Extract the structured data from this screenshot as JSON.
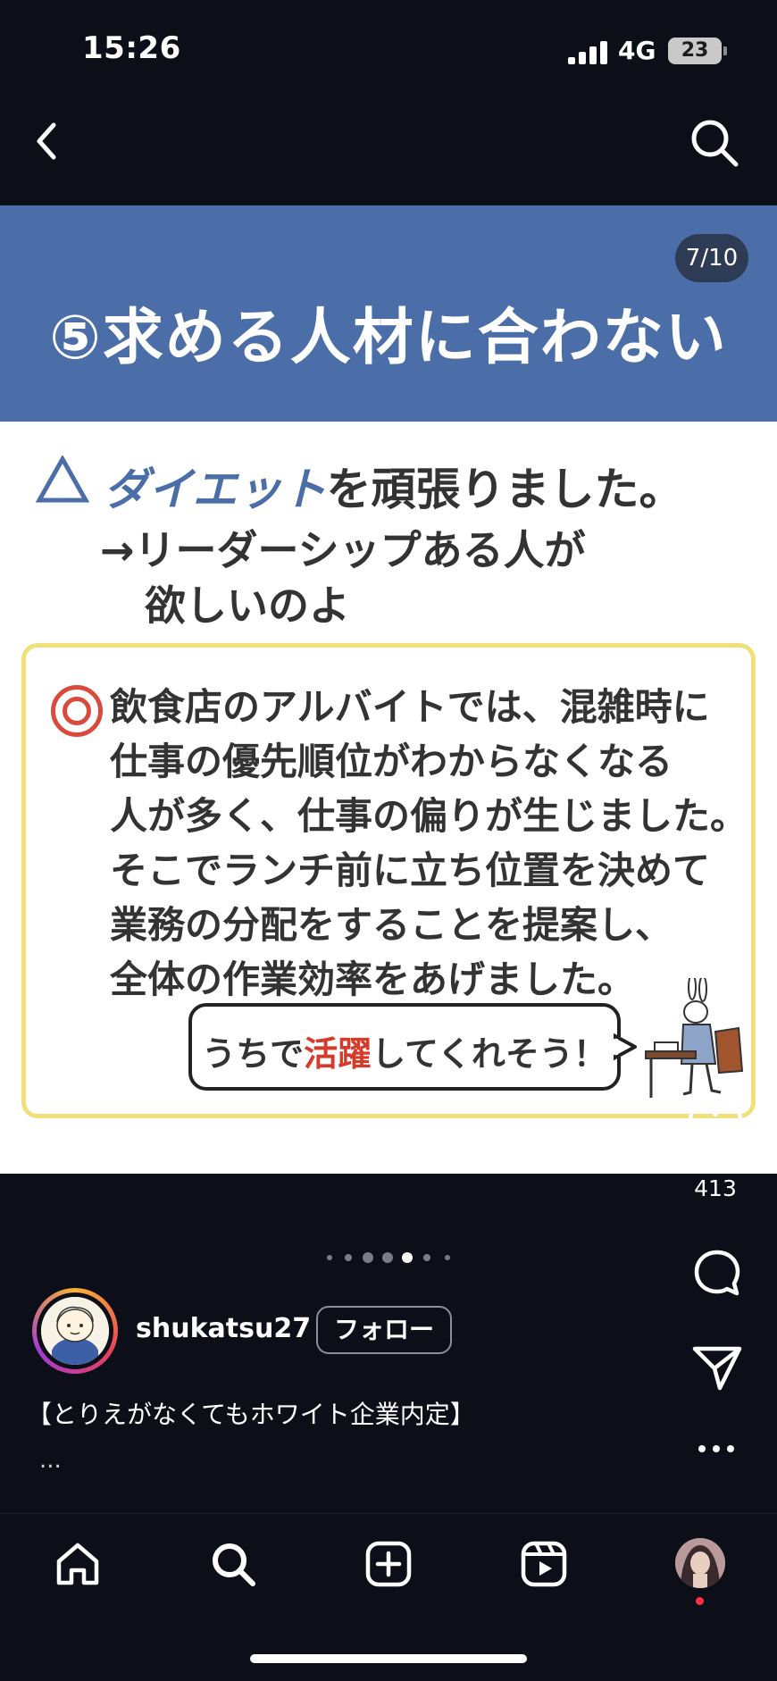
{
  "status_bar": {
    "time": "15:26",
    "network": "4G",
    "battery": "23"
  },
  "header": {
    "back_icon": "chevron-left-icon",
    "search_icon": "search-icon"
  },
  "post": {
    "page_counter": "7/10",
    "banner_title": "⑤求める人材に合わない",
    "bad_example": {
      "mark": "△",
      "highlight": "ダイエット",
      "rest": "を頑張りました。",
      "comment_line1": "→リーダーシップある人が",
      "comment_line2": "欲しいのよ"
    },
    "good_example": {
      "mark": "◎",
      "lines": [
        "飲食店のアルバイトでは、混雑時に",
        "仕事の優先順位がわからなくなる",
        "人が多く、仕事の偏りが生じました。",
        "そこでランチ前に立ち位置を決めて",
        "業務の分配をすることを提案し、",
        "全体の作業効率をあげました。"
      ],
      "speech_prefix": "うちで",
      "speech_highlight": "活躍",
      "speech_suffix": "してくれそう！"
    },
    "colors": {
      "banner": "#4b6ea8",
      "box_border": "#efe07a",
      "accent_red": "#d63a2b"
    }
  },
  "actions": {
    "like_count": "413",
    "like_icon": "heart-icon",
    "comment_icon": "comment-icon",
    "share_icon": "paper-plane-icon",
    "more_icon": "more-dots-icon"
  },
  "carousel": {
    "total": 7,
    "active_index": 4
  },
  "author": {
    "username": "shukatsu27",
    "follow_label": "フォロー"
  },
  "caption": {
    "text": "【とりえがなくてもホワイト企業内定】",
    "more": "..."
  },
  "bottom_nav": {
    "items": [
      "home-icon",
      "search-icon",
      "create-icon",
      "reels-icon",
      "profile-avatar"
    ]
  }
}
